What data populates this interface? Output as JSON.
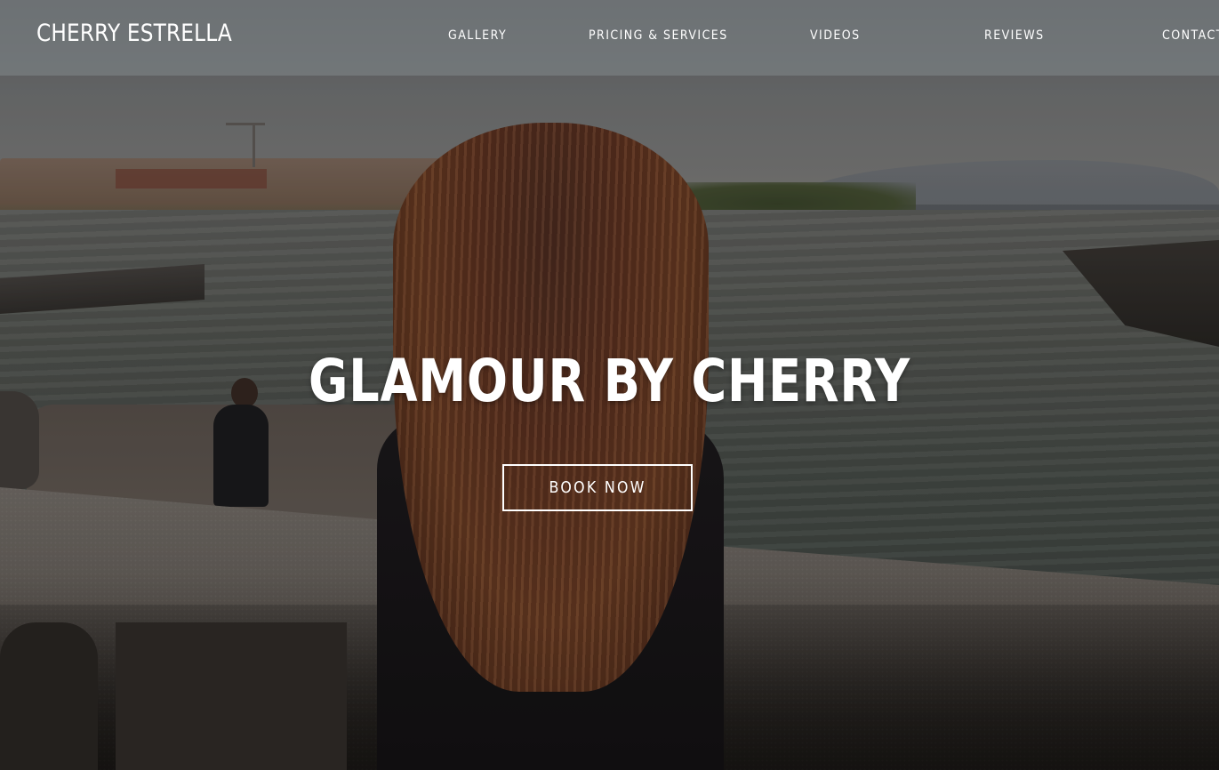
{
  "header": {
    "brand": "CHERRY ESTRELLA",
    "nav": [
      {
        "label": "GALLERY"
      },
      {
        "label": "PRICING & SERVICES"
      },
      {
        "label": "VIDEOS"
      },
      {
        "label": "REVIEWS"
      },
      {
        "label": "CONTACT"
      }
    ]
  },
  "hero": {
    "title": "GLAMOUR BY CHERRY",
    "cta_label": "BOOK NOW",
    "background_image": "woman-with-long-hair-at-lakeside-railing"
  },
  "colors": {
    "text": "#ffffff",
    "header_overlay": "#82888d"
  }
}
